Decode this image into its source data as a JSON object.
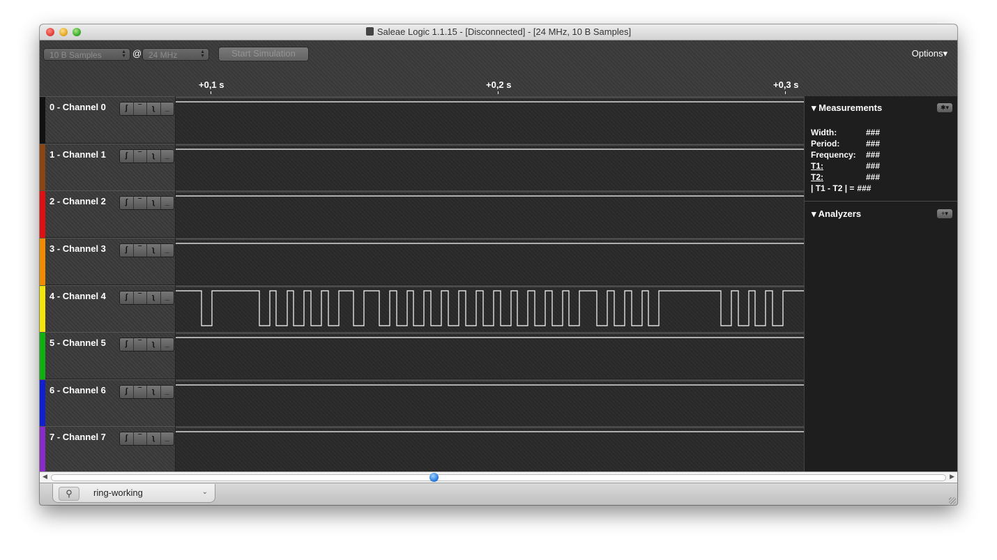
{
  "window": {
    "title": "Saleae Logic 1.1.15 - [Disconnected] - [24 MHz, 10 B Samples]"
  },
  "toolbar": {
    "samples_value": "10 B Samples",
    "at_label": "@",
    "rate_value": "24 MHz",
    "start_label": "Start Simulation",
    "options_label": "Options▾"
  },
  "ruler": {
    "ticks": [
      "+0,1 s",
      "+0,2 s",
      "+0,3 s"
    ]
  },
  "channels": [
    {
      "name": "0 - Channel 0",
      "color": "#111111",
      "signal": "high"
    },
    {
      "name": "1 - Channel 1",
      "color": "#8B4513",
      "signal": "high"
    },
    {
      "name": "2 - Channel 2",
      "color": "#E01010",
      "signal": "high"
    },
    {
      "name": "3 - Channel 3",
      "color": "#F08C00",
      "signal": "high"
    },
    {
      "name": "4 - Channel 4",
      "color": "#F5E60A",
      "signal": "pulses"
    },
    {
      "name": "5 - Channel 5",
      "color": "#10B010",
      "signal": "high"
    },
    {
      "name": "6 - Channel 6",
      "color": "#1020D0",
      "signal": "high"
    },
    {
      "name": "7 - Channel 7",
      "color": "#8A2BC8",
      "signal": "high"
    }
  ],
  "trigger_glyphs": [
    "ʃ",
    "‾",
    "ʅ",
    "_"
  ],
  "measurements": {
    "header": "Measurements",
    "rows": [
      {
        "key": "Width:",
        "value": "###"
      },
      {
        "key": "Period:",
        "value": "###"
      },
      {
        "key": "Frequency:",
        "value": "###"
      },
      {
        "key": "T1:",
        "value": "###"
      },
      {
        "key": "T2:",
        "value": "###"
      },
      {
        "key": "| T1 - T2 | =",
        "value": "###"
      }
    ]
  },
  "analyzers": {
    "header": "Analyzers"
  },
  "tab": {
    "name": "ring-working"
  }
}
